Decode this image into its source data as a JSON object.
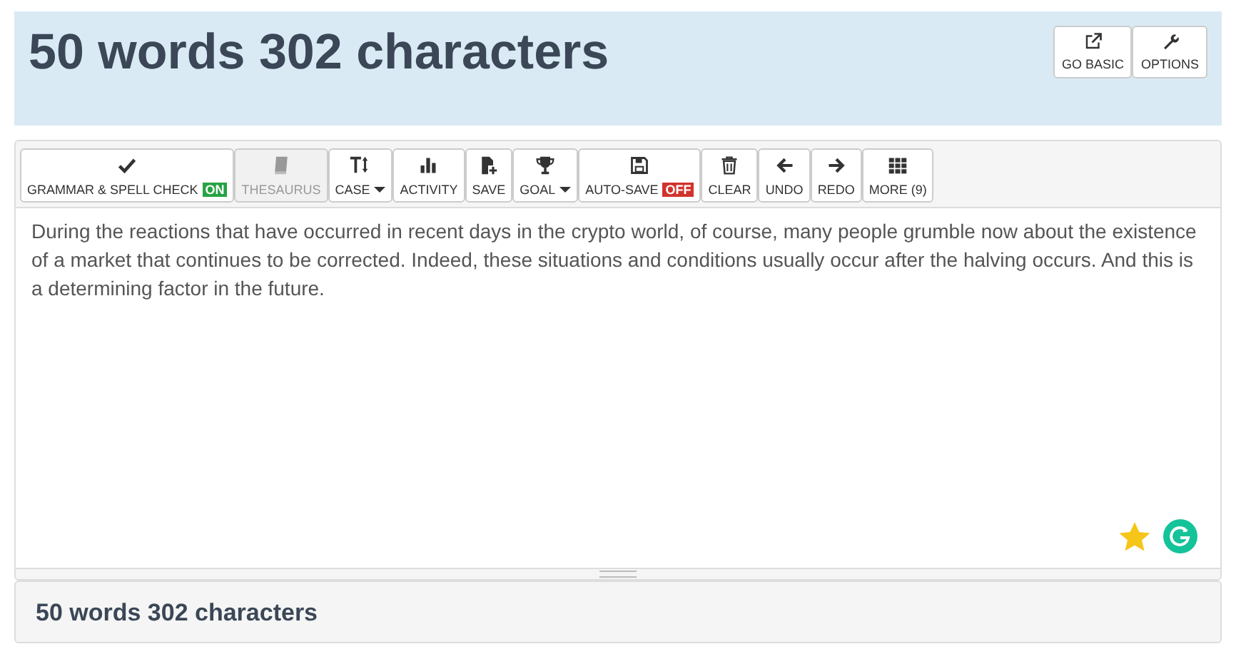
{
  "header": {
    "title": "50 words 302 characters",
    "buttons": [
      {
        "label": "GO BASIC"
      },
      {
        "label": "OPTIONS"
      }
    ]
  },
  "toolbar": [
    {
      "label": "GRAMMAR & SPELL CHECK",
      "disabled": false,
      "dropdown": false,
      "badge": {
        "text": "ON",
        "on": true
      }
    },
    {
      "label": "THESAURUS",
      "disabled": true,
      "dropdown": false
    },
    {
      "label": "CASE",
      "disabled": false,
      "dropdown": true
    },
    {
      "label": "ACTIVITY",
      "disabled": false,
      "dropdown": false
    },
    {
      "label": "SAVE",
      "disabled": false,
      "dropdown": false
    },
    {
      "label": "GOAL",
      "disabled": false,
      "dropdown": true
    },
    {
      "label": "AUTO-SAVE",
      "disabled": false,
      "dropdown": false,
      "badge": {
        "text": "OFF",
        "on": false
      }
    },
    {
      "label": "CLEAR",
      "disabled": false,
      "dropdown": false
    },
    {
      "label": "UNDO",
      "disabled": false,
      "dropdown": false
    },
    {
      "label": "REDO",
      "disabled": false,
      "dropdown": false
    },
    {
      "label": "MORE (9)",
      "disabled": false,
      "dropdown": false
    }
  ],
  "editor": {
    "value": "During the reactions that have occurred in recent days in the crypto world, of course, many people grumble now about the existence of a market that continues to be corrected. Indeed, these situations and conditions usually occur after the halving occurs. And this is a determining factor in the future."
  },
  "footer": {
    "text": "50 words 302 characters"
  }
}
